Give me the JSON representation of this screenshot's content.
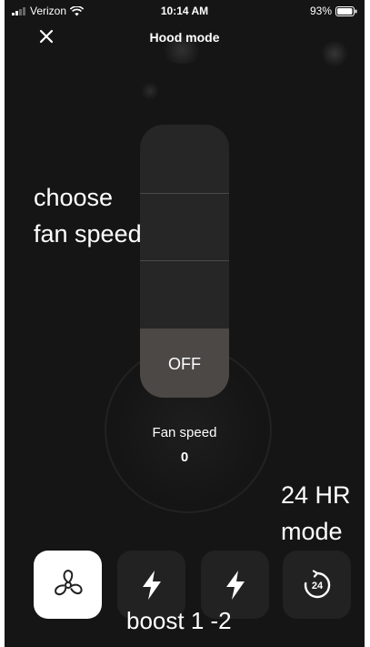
{
  "status_bar": {
    "carrier": "Verizon",
    "time": "10:14 AM",
    "battery": "93%"
  },
  "header": {
    "title": "Hood mode",
    "close_icon": "close-icon"
  },
  "fan_slider": {
    "off_label": "OFF"
  },
  "fan_speed": {
    "label": "Fan speed",
    "value": "0"
  },
  "annotations": {
    "choose_fan_speed": "choose fan speed",
    "hr_mode": "24 HR mode",
    "boost": "boost 1 -2"
  },
  "bottom_buttons": [
    {
      "icon": "fan-icon",
      "active": true
    },
    {
      "icon": "lightning-icon",
      "active": false
    },
    {
      "icon": "lightning-icon",
      "active": false
    },
    {
      "icon": "24hr-icon",
      "label": "24",
      "active": false
    }
  ]
}
